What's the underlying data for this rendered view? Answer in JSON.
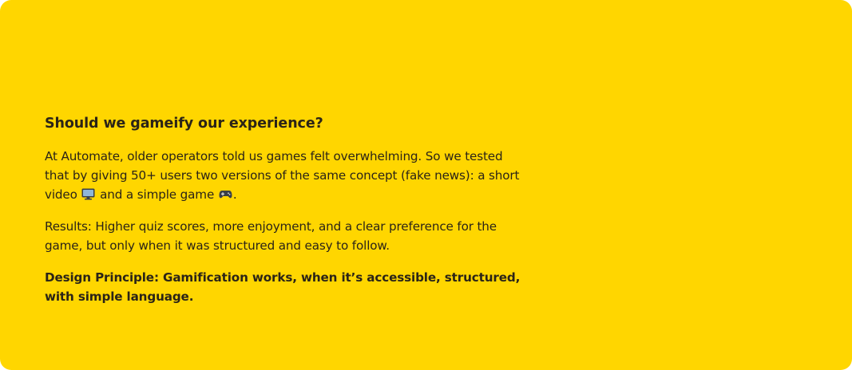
{
  "colors": {
    "card_background": "#FFD600",
    "text": "#2B2417"
  },
  "card": {
    "heading": "Should we gameify our experience?",
    "paragraph1": {
      "part1": "At Automate, older operators told us games felt overwhelming. So we tested that by giving 50+ users two versions of the same concept (fake news): a short video",
      "icon1": "tv-icon",
      "part2": "and a simple game",
      "icon2": "gamepad-icon",
      "part3": "."
    },
    "paragraph2": "Results: Higher quiz scores, more enjoyment, and a clear preference for the game, but only when it was structured and easy to follow.",
    "paragraph3": "Design Principle: Gamification works, when it’s accessible, structured, with simple language."
  }
}
